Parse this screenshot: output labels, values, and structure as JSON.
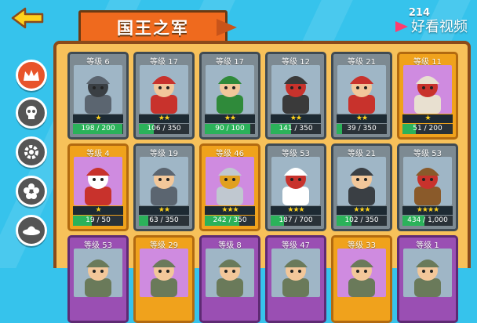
{
  "title": "国王之军",
  "coin_count": "214",
  "watermark": "好看视频",
  "side_menu": [
    {
      "id": "crown",
      "icon": "crown-icon",
      "active": true
    },
    {
      "id": "skull",
      "icon": "skull-icon",
      "active": false
    },
    {
      "id": "gear",
      "icon": "gear-icon",
      "active": false
    },
    {
      "id": "flower",
      "icon": "flower-icon",
      "active": false
    },
    {
      "id": "ufo",
      "icon": "ufo-icon",
      "active": false
    }
  ],
  "units": [
    {
      "level": "等级 6",
      "stars": "★",
      "progress": "198 / 200",
      "fill": 0.99,
      "frame": "gray",
      "theme": "tower"
    },
    {
      "level": "等级 17",
      "stars": "★★",
      "progress": "106 / 350",
      "fill": 0.3,
      "frame": "gray",
      "theme": "red"
    },
    {
      "level": "等级 17",
      "stars": "★★",
      "progress": "90 / 100",
      "fill": 0.9,
      "frame": "gray",
      "theme": "green"
    },
    {
      "level": "等级 12",
      "stars": "★★",
      "progress": "141 / 350",
      "fill": 0.4,
      "frame": "gray",
      "theme": "knight"
    },
    {
      "level": "等级 21",
      "stars": "★★",
      "progress": "39 / 350",
      "fill": 0.11,
      "frame": "gray",
      "theme": "archer"
    },
    {
      "level": "等级 11",
      "stars": "★",
      "progress": "51 / 200",
      "fill": 0.26,
      "frame": "gold",
      "theme": "bishop"
    },
    {
      "level": "等级 4",
      "stars": "★",
      "progress": "19 / 50",
      "fill": 0.38,
      "frame": "gold",
      "theme": "king"
    },
    {
      "level": "等级 19",
      "stars": "★★",
      "progress": "63 / 350",
      "fill": 0.18,
      "frame": "gray",
      "theme": "spear"
    },
    {
      "level": "等级 46",
      "stars": "★★★",
      "progress": "242 / 350",
      "fill": 0.69,
      "frame": "gold",
      "theme": "royal"
    },
    {
      "level": "等级 53",
      "stars": "★★★",
      "progress": "187 / 700",
      "fill": 0.27,
      "frame": "gray",
      "theme": "crusader"
    },
    {
      "level": "等级 21",
      "stars": "★★★",
      "progress": "102 / 350",
      "fill": 0.29,
      "frame": "gray",
      "theme": "musket"
    },
    {
      "level": "等级 53",
      "stars": "★★★★",
      "progress": "434 / 1,000",
      "fill": 0.43,
      "frame": "gray",
      "theme": "engineer"
    },
    {
      "level": "等级 53",
      "stars": "",
      "progress": "",
      "fill": 0,
      "frame": "purple",
      "theme": "p1"
    },
    {
      "level": "等级 29",
      "stars": "",
      "progress": "",
      "fill": 0,
      "frame": "gold",
      "theme": "p2"
    },
    {
      "level": "等级 8",
      "stars": "",
      "progress": "",
      "fill": 0,
      "frame": "purple",
      "theme": "p3"
    },
    {
      "level": "等级 47",
      "stars": "",
      "progress": "",
      "fill": 0,
      "frame": "purple",
      "theme": "p4"
    },
    {
      "level": "等级 33",
      "stars": "",
      "progress": "",
      "fill": 0,
      "frame": "gold",
      "theme": "p5"
    },
    {
      "level": "等级 1",
      "stars": "",
      "progress": "",
      "fill": 0,
      "frame": "purple",
      "theme": "p6"
    }
  ],
  "colors": {
    "accent": "#ef6a1e",
    "bar": "#2bb25a",
    "panel": "#f7c15a",
    "sky": "#36c3ec"
  }
}
